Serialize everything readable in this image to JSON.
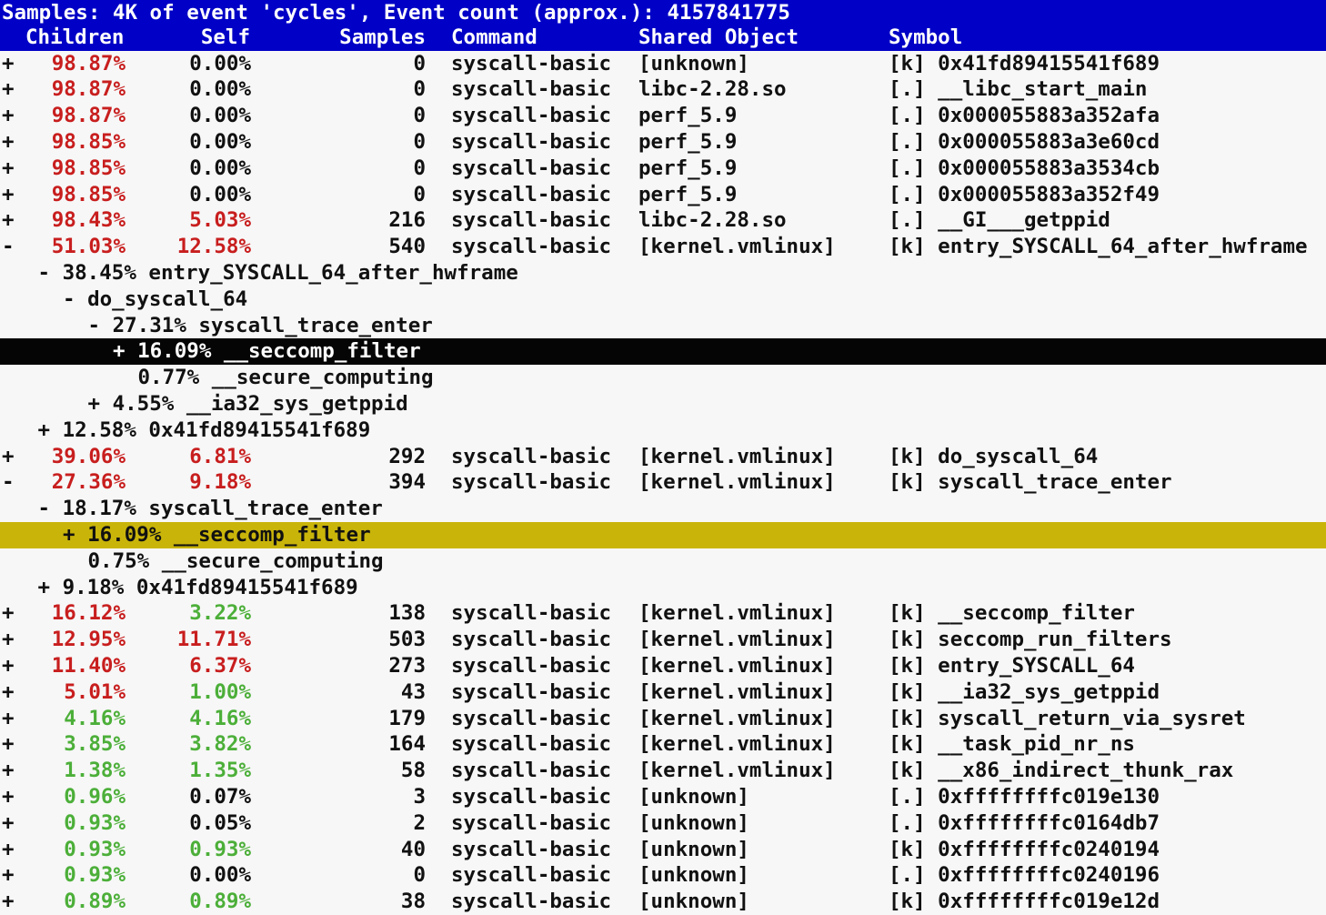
{
  "title_bar": "Samples: 4K of event 'cycles', Event count (approx.): 4157841775",
  "headers": {
    "children": "Children",
    "self": "Self",
    "samples": "Samples",
    "command": "Command",
    "shared_object": "Shared Object",
    "symbol": "Symbol"
  },
  "colors": {
    "header_bg": "#0000c6",
    "high_pct": "#c81e1e",
    "low_pct": "#4caf39",
    "selected_bg": "#050505",
    "highlight_bg": "#c9b40a"
  },
  "rows": [
    {
      "type": "entry",
      "sign": "+",
      "children": "98.87%",
      "children_color": "red",
      "self": "0.00%",
      "self_color": "plain",
      "samples": "0",
      "command": "syscall-basic",
      "dso": "[unknown]",
      "symbol": "[k] 0x41fd89415541f689"
    },
    {
      "type": "entry",
      "sign": "+",
      "children": "98.87%",
      "children_color": "red",
      "self": "0.00%",
      "self_color": "plain",
      "samples": "0",
      "command": "syscall-basic",
      "dso": "libc-2.28.so",
      "symbol": "[.] __libc_start_main"
    },
    {
      "type": "entry",
      "sign": "+",
      "children": "98.87%",
      "children_color": "red",
      "self": "0.00%",
      "self_color": "plain",
      "samples": "0",
      "command": "syscall-basic",
      "dso": "perf_5.9",
      "symbol": "[.] 0x000055883a352afa"
    },
    {
      "type": "entry",
      "sign": "+",
      "children": "98.85%",
      "children_color": "red",
      "self": "0.00%",
      "self_color": "plain",
      "samples": "0",
      "command": "syscall-basic",
      "dso": "perf_5.9",
      "symbol": "[.] 0x000055883a3e60cd"
    },
    {
      "type": "entry",
      "sign": "+",
      "children": "98.85%",
      "children_color": "red",
      "self": "0.00%",
      "self_color": "plain",
      "samples": "0",
      "command": "syscall-basic",
      "dso": "perf_5.9",
      "symbol": "[.] 0x000055883a3534cb"
    },
    {
      "type": "entry",
      "sign": "+",
      "children": "98.85%",
      "children_color": "red",
      "self": "0.00%",
      "self_color": "plain",
      "samples": "0",
      "command": "syscall-basic",
      "dso": "perf_5.9",
      "symbol": "[.] 0x000055883a352f49"
    },
    {
      "type": "entry",
      "sign": "+",
      "children": "98.43%",
      "children_color": "red",
      "self": "5.03%",
      "self_color": "red",
      "samples": "216",
      "command": "syscall-basic",
      "dso": "libc-2.28.so",
      "symbol": "[.] __GI___getppid"
    },
    {
      "type": "entry",
      "sign": "-",
      "children": "51.03%",
      "children_color": "red",
      "self": "12.58%",
      "self_color": "red",
      "samples": "540",
      "command": "syscall-basic",
      "dso": "[kernel.vmlinux]",
      "symbol": "[k] entry_SYSCALL_64_after_hwframe"
    },
    {
      "type": "tree",
      "indent": 2,
      "text": "- 38.45% entry_SYSCALL_64_after_hwframe"
    },
    {
      "type": "tree",
      "indent": 4,
      "text": "- do_syscall_64"
    },
    {
      "type": "tree",
      "indent": 6,
      "text": "- 27.31% syscall_trace_enter"
    },
    {
      "type": "tree",
      "indent": 8,
      "text": "+ 16.09% __seccomp_filter",
      "highlight": "black"
    },
    {
      "type": "tree",
      "indent": 10,
      "text": "0.77% __secure_computing"
    },
    {
      "type": "tree",
      "indent": 6,
      "text": "+ 4.55% __ia32_sys_getppid"
    },
    {
      "type": "tree",
      "indent": 2,
      "text": "+ 12.58% 0x41fd89415541f689"
    },
    {
      "type": "entry",
      "sign": "+",
      "children": "39.06%",
      "children_color": "red",
      "self": "6.81%",
      "self_color": "red",
      "samples": "292",
      "command": "syscall-basic",
      "dso": "[kernel.vmlinux]",
      "symbol": "[k] do_syscall_64"
    },
    {
      "type": "entry",
      "sign": "-",
      "children": "27.36%",
      "children_color": "red",
      "self": "9.18%",
      "self_color": "red",
      "samples": "394",
      "command": "syscall-basic",
      "dso": "[kernel.vmlinux]",
      "symbol": "[k] syscall_trace_enter"
    },
    {
      "type": "tree",
      "indent": 2,
      "text": "- 18.17% syscall_trace_enter"
    },
    {
      "type": "tree",
      "indent": 4,
      "text": "+ 16.09% __seccomp_filter",
      "highlight": "yellow"
    },
    {
      "type": "tree",
      "indent": 6,
      "text": "0.75% __secure_computing"
    },
    {
      "type": "tree",
      "indent": 2,
      "text": "+ 9.18% 0x41fd89415541f689"
    },
    {
      "type": "entry",
      "sign": "+",
      "children": "16.12%",
      "children_color": "red",
      "self": "3.22%",
      "self_color": "green",
      "samples": "138",
      "command": "syscall-basic",
      "dso": "[kernel.vmlinux]",
      "symbol": "[k] __seccomp_filter"
    },
    {
      "type": "entry",
      "sign": "+",
      "children": "12.95%",
      "children_color": "red",
      "self": "11.71%",
      "self_color": "red",
      "samples": "503",
      "command": "syscall-basic",
      "dso": "[kernel.vmlinux]",
      "symbol": "[k] seccomp_run_filters"
    },
    {
      "type": "entry",
      "sign": "+",
      "children": "11.40%",
      "children_color": "red",
      "self": "6.37%",
      "self_color": "red",
      "samples": "273",
      "command": "syscall-basic",
      "dso": "[kernel.vmlinux]",
      "symbol": "[k] entry_SYSCALL_64"
    },
    {
      "type": "entry",
      "sign": "+",
      "children": "5.01%",
      "children_color": "red",
      "self": "1.00%",
      "self_color": "green",
      "samples": "43",
      "command": "syscall-basic",
      "dso": "[kernel.vmlinux]",
      "symbol": "[k] __ia32_sys_getppid"
    },
    {
      "type": "entry",
      "sign": "+",
      "children": "4.16%",
      "children_color": "green",
      "self": "4.16%",
      "self_color": "green",
      "samples": "179",
      "command": "syscall-basic",
      "dso": "[kernel.vmlinux]",
      "symbol": "[k] syscall_return_via_sysret"
    },
    {
      "type": "entry",
      "sign": "+",
      "children": "3.85%",
      "children_color": "green",
      "self": "3.82%",
      "self_color": "green",
      "samples": "164",
      "command": "syscall-basic",
      "dso": "[kernel.vmlinux]",
      "symbol": "[k] __task_pid_nr_ns"
    },
    {
      "type": "entry",
      "sign": "+",
      "children": "1.38%",
      "children_color": "green",
      "self": "1.35%",
      "self_color": "green",
      "samples": "58",
      "command": "syscall-basic",
      "dso": "[kernel.vmlinux]",
      "symbol": "[k] __x86_indirect_thunk_rax"
    },
    {
      "type": "entry",
      "sign": "+",
      "children": "0.96%",
      "children_color": "green",
      "self": "0.07%",
      "self_color": "plain",
      "samples": "3",
      "command": "syscall-basic",
      "dso": "[unknown]",
      "symbol": "[.] 0xffffffffc019e130"
    },
    {
      "type": "entry",
      "sign": "+",
      "children": "0.93%",
      "children_color": "green",
      "self": "0.05%",
      "self_color": "plain",
      "samples": "2",
      "command": "syscall-basic",
      "dso": "[unknown]",
      "symbol": "[.] 0xffffffffc0164db7"
    },
    {
      "type": "entry",
      "sign": "+",
      "children": "0.93%",
      "children_color": "green",
      "self": "0.93%",
      "self_color": "green",
      "samples": "40",
      "command": "syscall-basic",
      "dso": "[unknown]",
      "symbol": "[k] 0xffffffffc0240194"
    },
    {
      "type": "entry",
      "sign": "+",
      "children": "0.93%",
      "children_color": "green",
      "self": "0.00%",
      "self_color": "plain",
      "samples": "0",
      "command": "syscall-basic",
      "dso": "[unknown]",
      "symbol": "[.] 0xffffffffc0240196"
    },
    {
      "type": "entry",
      "sign": "+",
      "children": "0.89%",
      "children_color": "green",
      "self": "0.89%",
      "self_color": "green",
      "samples": "38",
      "command": "syscall-basic",
      "dso": "[unknown]",
      "symbol": "[k] 0xffffffffc019e12d"
    }
  ]
}
